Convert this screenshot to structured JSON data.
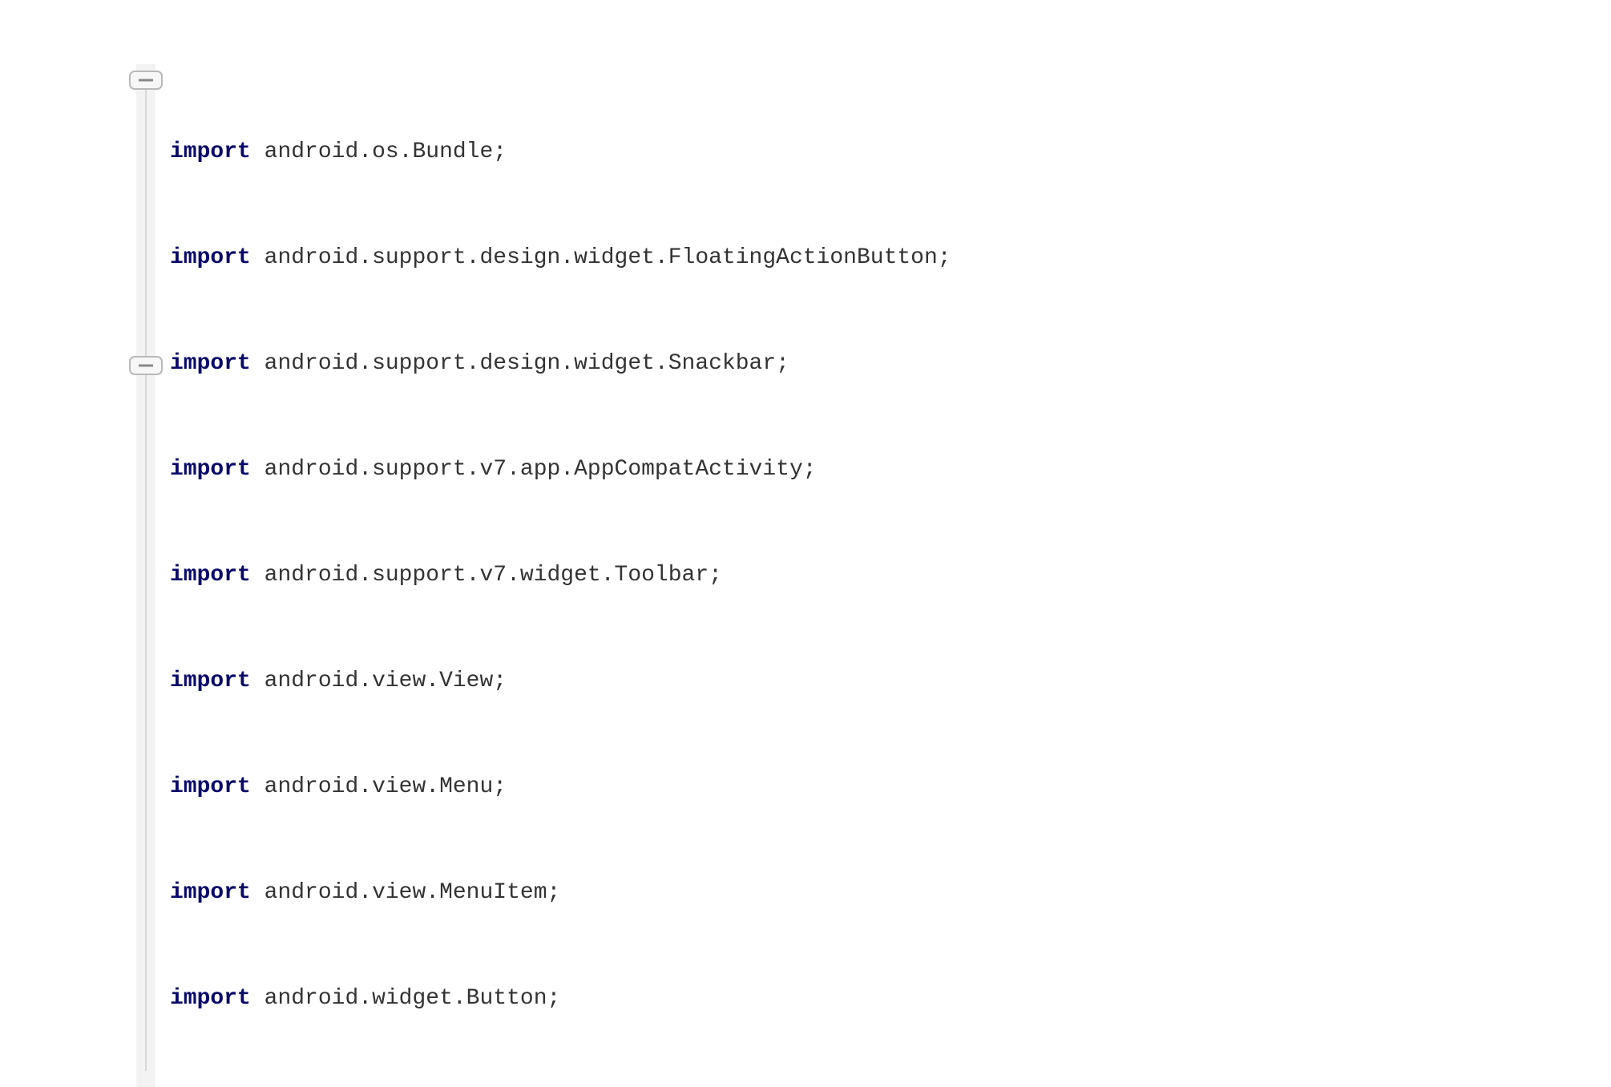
{
  "code": {
    "keyword": "import",
    "lines": [
      "android.os.Bundle;",
      "android.support.design.widget.FloatingActionButton;",
      "android.support.design.widget.Snackbar;",
      "android.support.v7.app.AppCompatActivity;",
      "android.support.v7.widget.Toolbar;",
      "android.view.View;",
      "android.view.Menu;",
      "android.view.MenuItem;",
      "android.widget.Button;"
    ]
  },
  "colors": {
    "keyword": "#0a0a6a",
    "text": "#333333",
    "gutter_bg": "#f3f3f3",
    "gutter_line": "#d7d7d7",
    "marker_stroke": "#b9b9b9",
    "marker_fill": "#f7f7f7"
  }
}
